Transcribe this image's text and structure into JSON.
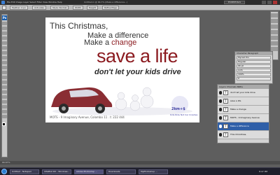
{
  "app": {
    "menu": "File  Edit  Image  Layer  Select  Filter  View  Window  Help",
    "title": "Untitled-1 @ 66.7% (Make a difference...)",
    "workspace": "ESSENTIALS"
  },
  "options": [
    "Feather: 0 px",
    "Anti-alias",
    "Style: Normal",
    "Width",
    "Height",
    "Refine Edge"
  ],
  "ad": {
    "line1": "This Christmas,",
    "line2": "Make a difference",
    "line3_prefix": "Make a ",
    "line3_accent": "change",
    "headline": "save a life",
    "sub_bold": "don't let your kids drive",
    "badge": "2km+$",
    "tagline": "Kids Ride Not Car Crashes",
    "address": "MOTS - 9 Imaginary Avenue, Colombo 11 . t: 222 444",
    "accent_color": "#8b1a1f"
  },
  "char_panel": {
    "tabs": "Character   Paragraph",
    "rows": [
      "Myriad Pro",
      "Regular",
      "66 pt",
      "Auto",
      "100%",
      "0",
      "Color"
    ]
  },
  "layers": {
    "tabs": "Layers  Channels  Paths",
    "items": [
      {
        "name": "don't let your kids drive",
        "thumb": "T"
      },
      {
        "name": "save a life",
        "thumb": "T"
      },
      {
        "name": "Make a change",
        "thumb": "T"
      },
      {
        "name": "MOTS - 9 Imaginary Avenue",
        "thumb": "T"
      },
      {
        "name": "Make a difference",
        "thumb": "T",
        "selected": true
      },
      {
        "name": "This Christmas,",
        "thumb": "T"
      }
    ]
  },
  "status": "66.67%",
  "taskbar": {
    "items": [
      "Untitled - Notepad",
      "CPaPlist #2 - Windows...",
      "Adobe Photoshop ...",
      "Downloads",
      "MyPhotoshop ..."
    ],
    "clock": "8:47 PM"
  }
}
